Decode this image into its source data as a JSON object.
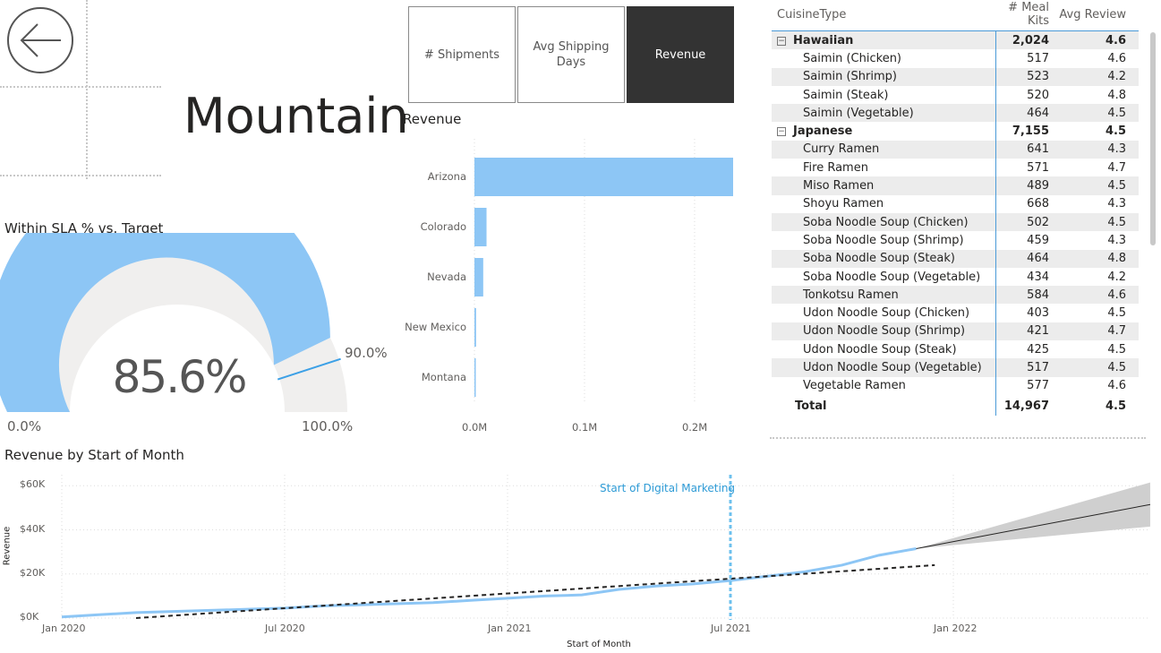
{
  "page": {
    "title": "Mountain"
  },
  "buttons": [
    {
      "label": "# Shipments",
      "active": false
    },
    {
      "label": "Avg Shipping Days",
      "active": false
    },
    {
      "label": "Revenue",
      "active": true
    }
  ],
  "gauge": {
    "title": "Within SLA % vs. Target",
    "value_label": "85.6%",
    "value": 85.6,
    "target_label": "90.0%",
    "target": 90.0,
    "min_label": "0.0%",
    "max_label": "100.0%",
    "fill_color": "#8dc6f5",
    "track_color": "#f0efee"
  },
  "bar_chart": {
    "title": "Revenue",
    "chart_data": {
      "type": "bar",
      "orientation": "horizontal",
      "categories": [
        "Arizona",
        "Colorado",
        "Nevada",
        "New Mexico",
        "Montana"
      ],
      "values": [
        235000,
        11000,
        8000,
        1500,
        1000
      ],
      "xlim": [
        0,
        235000
      ],
      "ticks": [
        "0.0M",
        "0.1M",
        "0.2M"
      ],
      "tick_values": [
        0,
        100000,
        200000
      ],
      "grid": true,
      "color": "#8dc6f5"
    }
  },
  "matrix": {
    "columns": [
      "CuisineType",
      "# Meal Kits",
      "Avg Review"
    ],
    "rows": [
      {
        "type": "group",
        "label": "Hawaiian",
        "kits": "2,024",
        "review": "4.6"
      },
      {
        "type": "child",
        "label": "Saimin (Chicken)",
        "kits": "517",
        "review": "4.6"
      },
      {
        "type": "child",
        "label": "Saimin (Shrimp)",
        "kits": "523",
        "review": "4.2"
      },
      {
        "type": "child",
        "label": "Saimin (Steak)",
        "kits": "520",
        "review": "4.8"
      },
      {
        "type": "child",
        "label": "Saimin (Vegetable)",
        "kits": "464",
        "review": "4.5"
      },
      {
        "type": "group",
        "label": "Japanese",
        "kits": "7,155",
        "review": "4.5"
      },
      {
        "type": "child",
        "label": "Curry Ramen",
        "kits": "641",
        "review": "4.3"
      },
      {
        "type": "child",
        "label": "Fire Ramen",
        "kits": "571",
        "review": "4.7"
      },
      {
        "type": "child",
        "label": "Miso Ramen",
        "kits": "489",
        "review": "4.5"
      },
      {
        "type": "child",
        "label": "Shoyu Ramen",
        "kits": "668",
        "review": "4.3"
      },
      {
        "type": "child",
        "label": "Soba Noodle Soup (Chicken)",
        "kits": "502",
        "review": "4.5"
      },
      {
        "type": "child",
        "label": "Soba Noodle Soup (Shrimp)",
        "kits": "459",
        "review": "4.3"
      },
      {
        "type": "child",
        "label": "Soba Noodle Soup (Steak)",
        "kits": "464",
        "review": "4.8"
      },
      {
        "type": "child",
        "label": "Soba Noodle Soup (Vegetable)",
        "kits": "434",
        "review": "4.2"
      },
      {
        "type": "child",
        "label": "Tonkotsu Ramen",
        "kits": "584",
        "review": "4.6"
      },
      {
        "type": "child",
        "label": "Udon Noodle Soup (Chicken)",
        "kits": "403",
        "review": "4.5"
      },
      {
        "type": "child",
        "label": "Udon Noodle Soup (Shrimp)",
        "kits": "421",
        "review": "4.7"
      },
      {
        "type": "child",
        "label": "Udon Noodle Soup (Steak)",
        "kits": "425",
        "review": "4.5"
      },
      {
        "type": "child",
        "label": "Udon Noodle Soup (Vegetable)",
        "kits": "517",
        "review": "4.5"
      },
      {
        "type": "child",
        "label": "Vegetable Ramen",
        "kits": "577",
        "review": "4.6"
      }
    ],
    "total": {
      "label": "Total",
      "kits": "14,967",
      "review": "4.5"
    },
    "expander_glyph": "−"
  },
  "line_chart": {
    "title": "Revenue by Start of Month",
    "marker_label": "Start of Digital Marketing",
    "chart_data": {
      "type": "line",
      "xlabel": "Start of Month",
      "ylabel": "Revenue",
      "x_ticks": [
        "Jan 2020",
        "Jul 2020",
        "Jan 2021",
        "Jul 2021",
        "Jan 2022"
      ],
      "y_ticks": [
        "$0K",
        "$20K",
        "$40K",
        "$60K"
      ],
      "y_tick_values": [
        0,
        20000,
        40000,
        60000
      ],
      "ylim": [
        0,
        65000
      ],
      "xlim_months": [
        0,
        29.3
      ],
      "grid": true,
      "marker_month": 18,
      "series": [
        {
          "name": "Revenue",
          "color": "#8dc6f5",
          "x_months": [
            0,
            1,
            2,
            3,
            4,
            5,
            6,
            7,
            8,
            9,
            10,
            11,
            12,
            13,
            14,
            15,
            16,
            17,
            18,
            19,
            20,
            21,
            22,
            23
          ],
          "values": [
            500,
            1500,
            2500,
            3000,
            3500,
            4000,
            4500,
            5500,
            6000,
            6500,
            7000,
            8000,
            9000,
            10000,
            10500,
            13000,
            14500,
            15500,
            17000,
            19000,
            21000,
            24000,
            28500,
            31500
          ]
        },
        {
          "name": "Trend",
          "color": "#252423",
          "style": "dashed",
          "x_months": [
            2,
            23.5
          ],
          "values": [
            0,
            24000
          ]
        },
        {
          "name": "Forecast",
          "color": "#252423",
          "x_months": [
            23,
            29.3
          ],
          "values": [
            31500,
            51500
          ],
          "band_upper": [
            31500,
            61500
          ],
          "band_lower": [
            31500,
            41500
          ],
          "band_color": "#cfcfcf"
        }
      ]
    }
  }
}
